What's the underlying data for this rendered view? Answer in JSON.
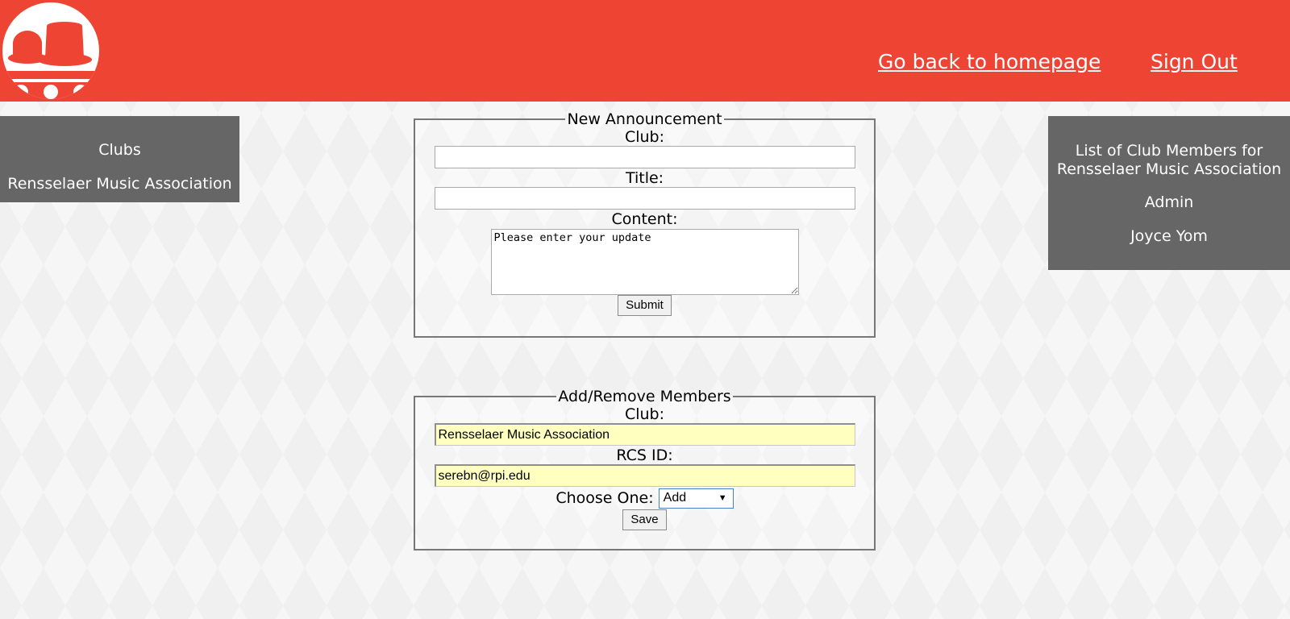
{
  "header": {
    "home_link": "Go back to homepage",
    "signout_link": "Sign Out",
    "brand_color": "#ee4434"
  },
  "sidebar_left": {
    "title": "Clubs",
    "items": [
      "Rensselaer Music Association"
    ]
  },
  "sidebar_right": {
    "title": "List of Club Members for Rensselaer Music Association",
    "members": [
      "Admin",
      "Joyce Yom"
    ]
  },
  "announcement_form": {
    "legend": "New Announcement",
    "club_label": "Club:",
    "club_value": "",
    "title_label": "Title:",
    "title_value": "",
    "content_label": "Content:",
    "content_value": "Please enter your update",
    "submit_label": "Submit"
  },
  "members_form": {
    "legend": "Add/Remove Members",
    "club_label": "Club:",
    "club_value": "Rensselaer Music Association",
    "rcs_label": "RCS ID:",
    "rcs_value": "serebn@rpi.edu",
    "choose_label": "Choose One:",
    "choose_value": "Add",
    "save_label": "Save"
  },
  "icons": {
    "logo": "top-hat-logo-icon",
    "dropdown": "chevron-down-icon"
  }
}
